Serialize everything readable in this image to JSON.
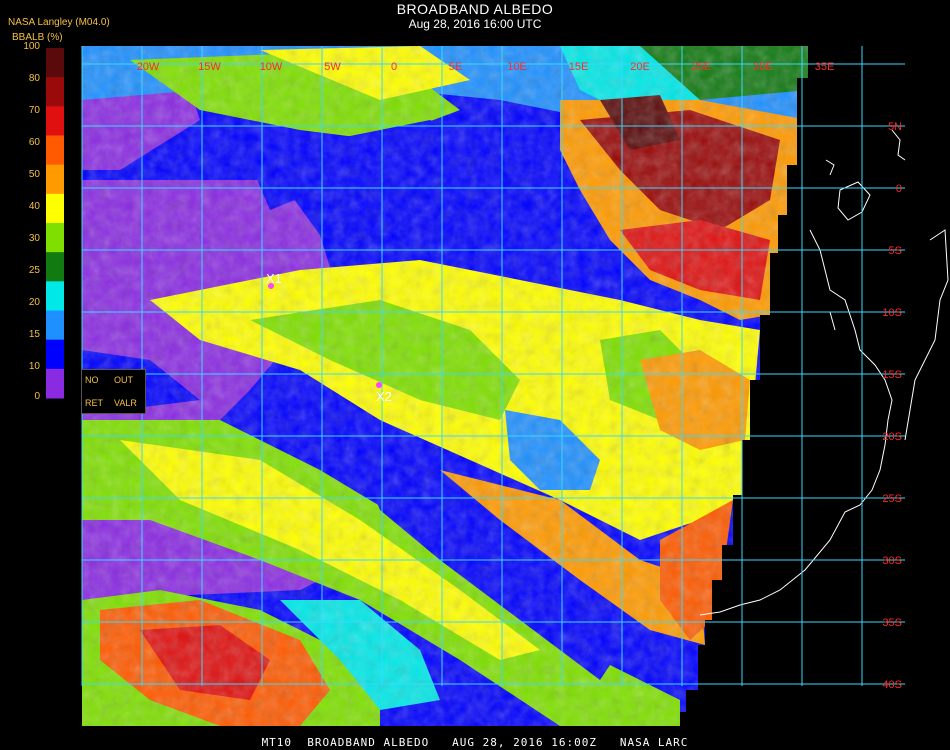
{
  "header": {
    "title": "BROADBAND ALBEDO",
    "subtitle": "Aug 28, 2016 16:00 UTC",
    "brand": "NASA Langley (M04.0)",
    "units": "BBALB (%)"
  },
  "footer": "MT10  BROADBAND ALBEDO   AUG 28, 2016 16:00Z   NASA LARC",
  "colorbar": {
    "ticks": [
      "100",
      "80",
      "70",
      "60",
      "50",
      "40",
      "30",
      "25",
      "20",
      "15",
      "10",
      "0"
    ],
    "colors": [
      "#5a0a0a",
      "#9a0a0a",
      "#e01010",
      "#ff5a00",
      "#ff9a00",
      "#ffff00",
      "#7fe000",
      "#117a11",
      "#00e8e8",
      "#1e90ff",
      "#0000ff",
      "#8a2be2"
    ],
    "missing_labels": {
      "no": "NO",
      "out": "OUT",
      "ret": "RET",
      "valr": "VALR"
    }
  },
  "map": {
    "lon_labels": [
      "20W",
      "15W",
      "10W",
      "5W",
      "0",
      "5E",
      "10E",
      "15E",
      "20E",
      "25E",
      "30E",
      "35E"
    ],
    "lat_labels": [
      "5N",
      "0",
      "5S",
      "10S",
      "15S",
      "20S",
      "25S",
      "30S",
      "35S",
      "40S"
    ],
    "markers": [
      "X1",
      "X2"
    ],
    "grid_color": "#3ad8ff",
    "label_color": "#ff2a2a"
  }
}
